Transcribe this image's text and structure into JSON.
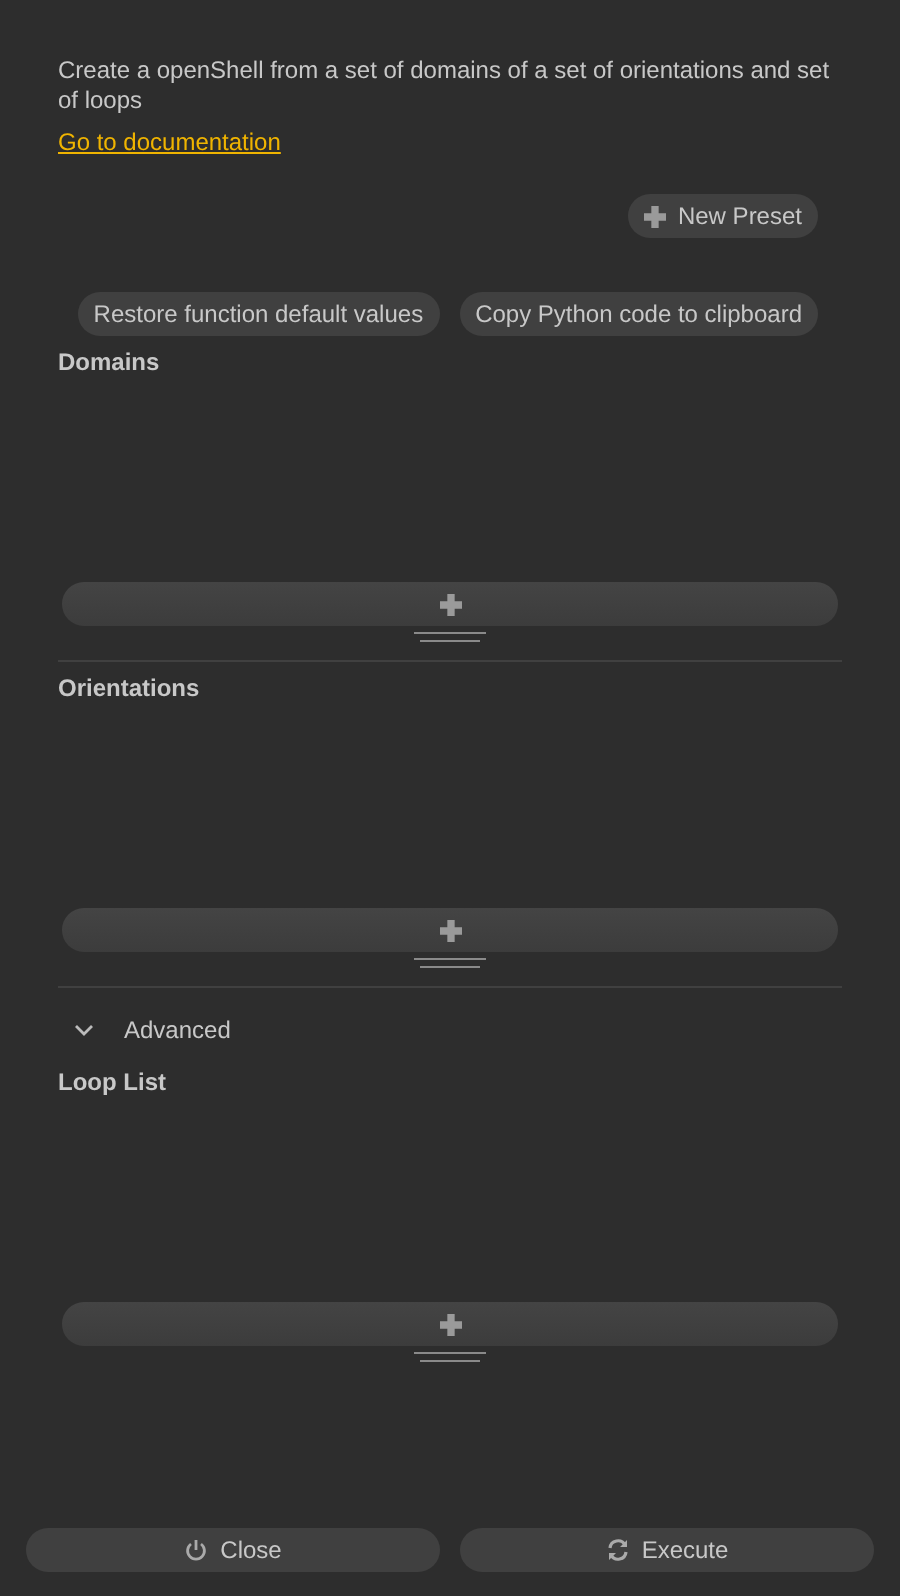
{
  "description": "Create a openShell from a set of domains of a set of orientations and set of loops",
  "link": "Go to documentation",
  "preset_button": "New Preset",
  "action_buttons": [
    "Restore function default values",
    "Copy Python code to clipboard"
  ],
  "sections": [
    {
      "kind": "list",
      "label": "Domains"
    },
    {
      "kind": "list",
      "label": "Orientations"
    },
    {
      "kind": "toggle",
      "label": "Advanced",
      "expanded": true
    },
    {
      "kind": "list",
      "label": "Loop List"
    }
  ],
  "footer": [
    {
      "kind": "close",
      "label": "Close"
    },
    {
      "kind": "execute",
      "label": "Execute"
    }
  ]
}
